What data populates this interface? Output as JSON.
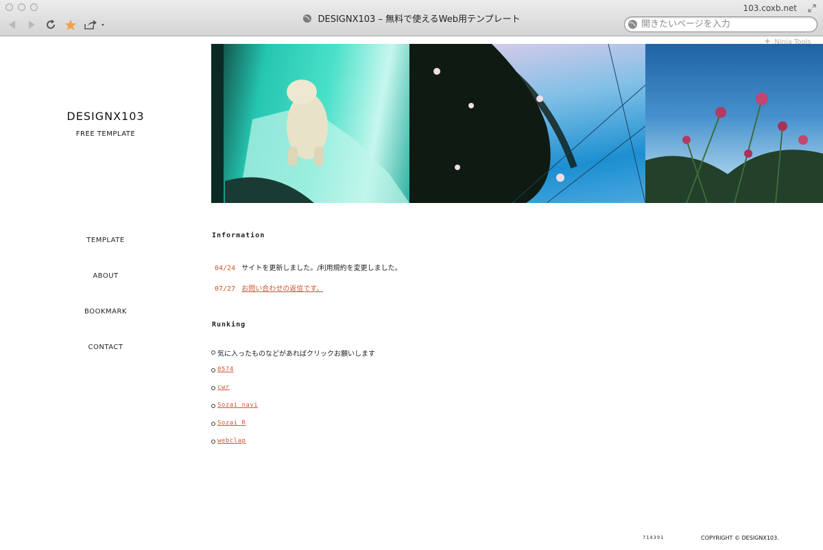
{
  "browser": {
    "window_title": "DESIGNX103 – 無料で使えるWeb用テンプレート",
    "domain": "103.coxb.net",
    "address_placeholder": "開きたいページを入力",
    "ninja_tools_label": "Ninja Tools"
  },
  "site": {
    "logo": "DESIGNX103",
    "tagline": "FREE TEMPLATE"
  },
  "nav": {
    "items": [
      {
        "label": "TEMPLATE"
      },
      {
        "label": "ABOUT"
      },
      {
        "label": "BOOKMARK"
      },
      {
        "label": "CONTACT"
      }
    ]
  },
  "information": {
    "title": "Information",
    "entries": [
      {
        "date": "04/24",
        "text": "サイトを更新しました。/利用規約を変更しました。",
        "is_link": false
      },
      {
        "date": "07/27",
        "text": "お問い合わせの返信です。",
        "is_link": true
      }
    ]
  },
  "ranking": {
    "title": "Runking",
    "intro": "気に入ったものなどがあればクリックお願いします",
    "links": [
      "0574",
      "cwr",
      "Sozai navi",
      "Sozai R",
      "webclap"
    ]
  },
  "footer": {
    "counter": "714391",
    "copyright": "COPYRIGHT © DESIGNX103."
  },
  "colors": {
    "accent": "#c8552d",
    "text": "#222222"
  }
}
